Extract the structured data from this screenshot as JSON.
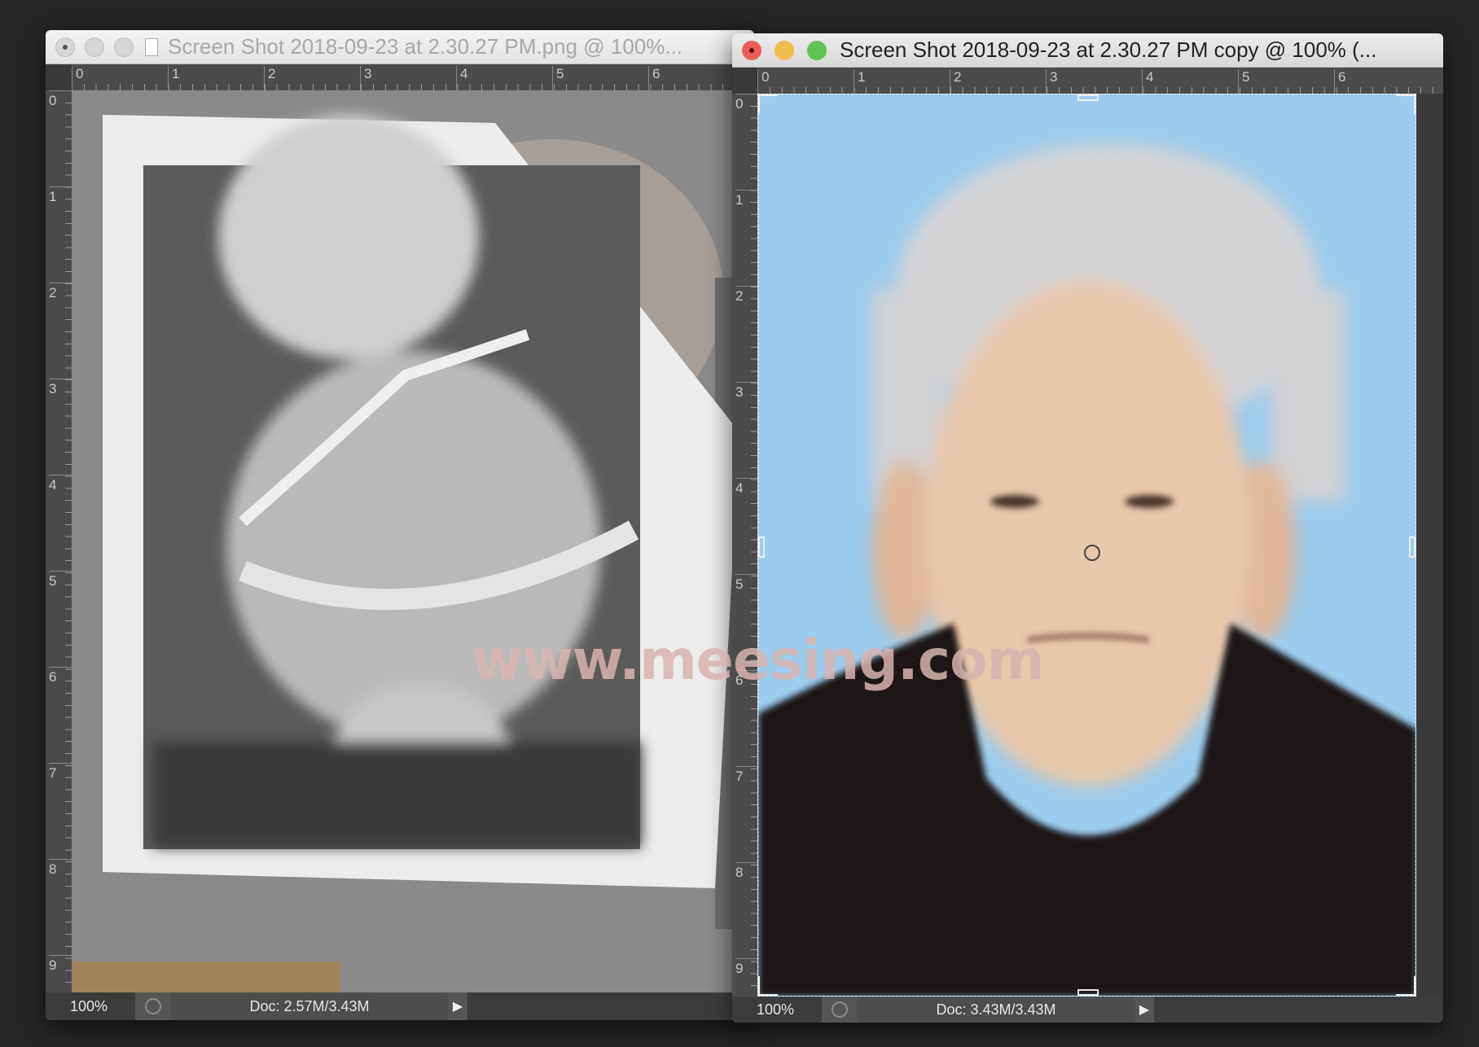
{
  "left_window": {
    "title": "Screen Shot 2018-09-23 at 2.30.27 PM.png @ 100%...",
    "ruler_h": [
      "0",
      "1",
      "2",
      "3",
      "4",
      "5",
      "6"
    ],
    "ruler_v": [
      "0",
      "1",
      "2",
      "3",
      "4",
      "5",
      "6",
      "7",
      "8",
      "9"
    ],
    "zoom": "100%",
    "doc": "Doc: 2.57M/3.43M"
  },
  "right_window": {
    "title": "Screen Shot 2018-09-23 at 2.30.27 PM copy @ 100% (...",
    "ruler_h": [
      "0",
      "1",
      "2",
      "3",
      "4",
      "5",
      "6"
    ],
    "ruler_v": [
      "0",
      "1",
      "2",
      "3",
      "4",
      "5",
      "6",
      "7",
      "8",
      "9"
    ],
    "zoom": "100%",
    "doc": "Doc: 3.43M/3.43M"
  },
  "watermark": "www.meesing.com",
  "colors": {
    "close": "#ec5f57",
    "minimize": "#f5bd4f",
    "zoom": "#5fc454",
    "sky": "#9ccdee"
  }
}
